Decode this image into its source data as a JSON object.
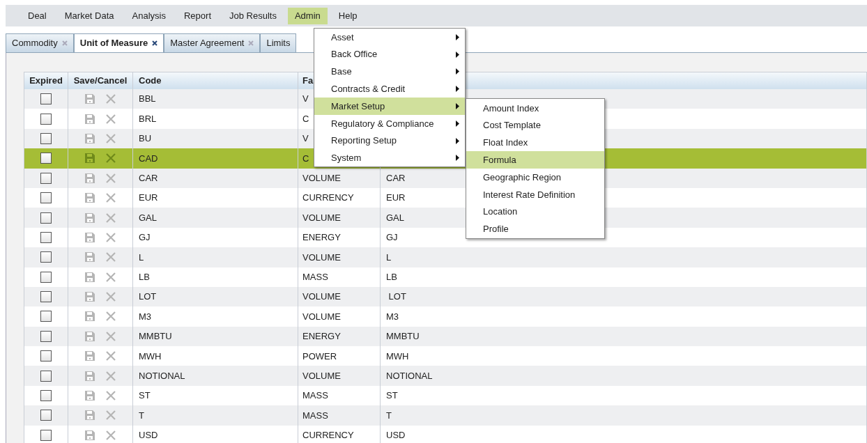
{
  "menu_bar": [
    {
      "label": "Deal",
      "selected": false
    },
    {
      "label": "Market Data",
      "selected": false
    },
    {
      "label": "Analysis",
      "selected": false
    },
    {
      "label": "Report",
      "selected": false
    },
    {
      "label": "Job Results",
      "selected": false
    },
    {
      "label": "Admin",
      "selected": true
    },
    {
      "label": "Help",
      "selected": false
    }
  ],
  "tabs": [
    {
      "label": "Commodity",
      "selected": false,
      "closable": true
    },
    {
      "label": "Unit of Measure",
      "selected": true,
      "closable": true
    },
    {
      "label": "Master Agreement",
      "selected": false,
      "closable": true
    },
    {
      "label": "Limits",
      "selected": false,
      "closable": false
    }
  ],
  "table": {
    "columns": [
      "Expired",
      "Save/Cancel",
      "Code",
      "Fa"
    ],
    "rows": [
      {
        "expired": false,
        "selected": false,
        "code": "BBL",
        "column_4": "V"
      },
      {
        "expired": false,
        "selected": false,
        "code": "BRL",
        "column_4": "C"
      },
      {
        "expired": false,
        "selected": false,
        "code": "BU",
        "column_4": "V"
      },
      {
        "expired": false,
        "selected": true,
        "code": "CAD",
        "column_4": "C"
      },
      {
        "expired": false,
        "selected": false,
        "code": "CAR",
        "column_4": "VOLUME",
        "column_5": "CAR"
      },
      {
        "expired": false,
        "selected": false,
        "code": "EUR",
        "column_4": "CURRENCY",
        "column_5": "EUR"
      },
      {
        "expired": false,
        "selected": false,
        "code": "GAL",
        "column_4": "VOLUME",
        "column_5": "GAL"
      },
      {
        "expired": false,
        "selected": false,
        "code": "GJ",
        "column_4": "ENERGY",
        "column_5": "GJ"
      },
      {
        "expired": false,
        "selected": false,
        "code": "L",
        "column_4": "VOLUME",
        "column_5": "L"
      },
      {
        "expired": false,
        "selected": false,
        "code": "LB",
        "column_4": "MASS",
        "column_5": "LB"
      },
      {
        "expired": false,
        "selected": false,
        "code": "LOT",
        "column_4": "VOLUME",
        "column_5": " LOT"
      },
      {
        "expired": false,
        "selected": false,
        "code": "M3",
        "column_4": "VOLUME",
        "column_5": "M3"
      },
      {
        "expired": false,
        "selected": false,
        "code": "MMBTU",
        "column_4": "ENERGY",
        "column_5": "MMBTU"
      },
      {
        "expired": false,
        "selected": false,
        "code": "MWH",
        "column_4": "POWER",
        "column_5": "MWH"
      },
      {
        "expired": false,
        "selected": false,
        "code": "NOTIONAL",
        "column_4": "VOLUME",
        "column_5": "NOTIONAL"
      },
      {
        "expired": false,
        "selected": false,
        "code": "ST",
        "column_4": "MASS",
        "column_5": "ST"
      },
      {
        "expired": false,
        "selected": false,
        "code": "T",
        "column_4": "MASS",
        "column_5": "T"
      },
      {
        "expired": false,
        "selected": false,
        "code": "USD",
        "column_4": "CURRENCY",
        "column_5": "USD"
      }
    ]
  },
  "admin_menu": {
    "items": [
      {
        "label": "Asset",
        "selected": false,
        "has_submenu": true
      },
      {
        "label": "Back Office",
        "selected": false,
        "has_submenu": true
      },
      {
        "label": "Base",
        "selected": false,
        "has_submenu": true
      },
      {
        "label": "Contracts & Credit",
        "selected": false,
        "has_submenu": true
      },
      {
        "label": "Market Setup",
        "selected": true,
        "has_submenu": true
      },
      {
        "label": "Regulatory & Compliance",
        "selected": false,
        "has_submenu": true
      },
      {
        "label": "Reporting Setup",
        "selected": false,
        "has_submenu": true
      },
      {
        "label": "System",
        "selected": false,
        "has_submenu": true
      }
    ]
  },
  "market_setup_menu": {
    "items": [
      {
        "label": "Amount Index",
        "selected": false
      },
      {
        "label": "Cost Template",
        "selected": false
      },
      {
        "label": "Float Index",
        "selected": false
      },
      {
        "label": "Formula",
        "selected": true
      },
      {
        "label": "Geographic Region",
        "selected": false
      },
      {
        "label": "Interest Rate Definition",
        "selected": false
      },
      {
        "label": "Location",
        "selected": false
      },
      {
        "label": "Profile",
        "selected": false
      }
    ]
  }
}
